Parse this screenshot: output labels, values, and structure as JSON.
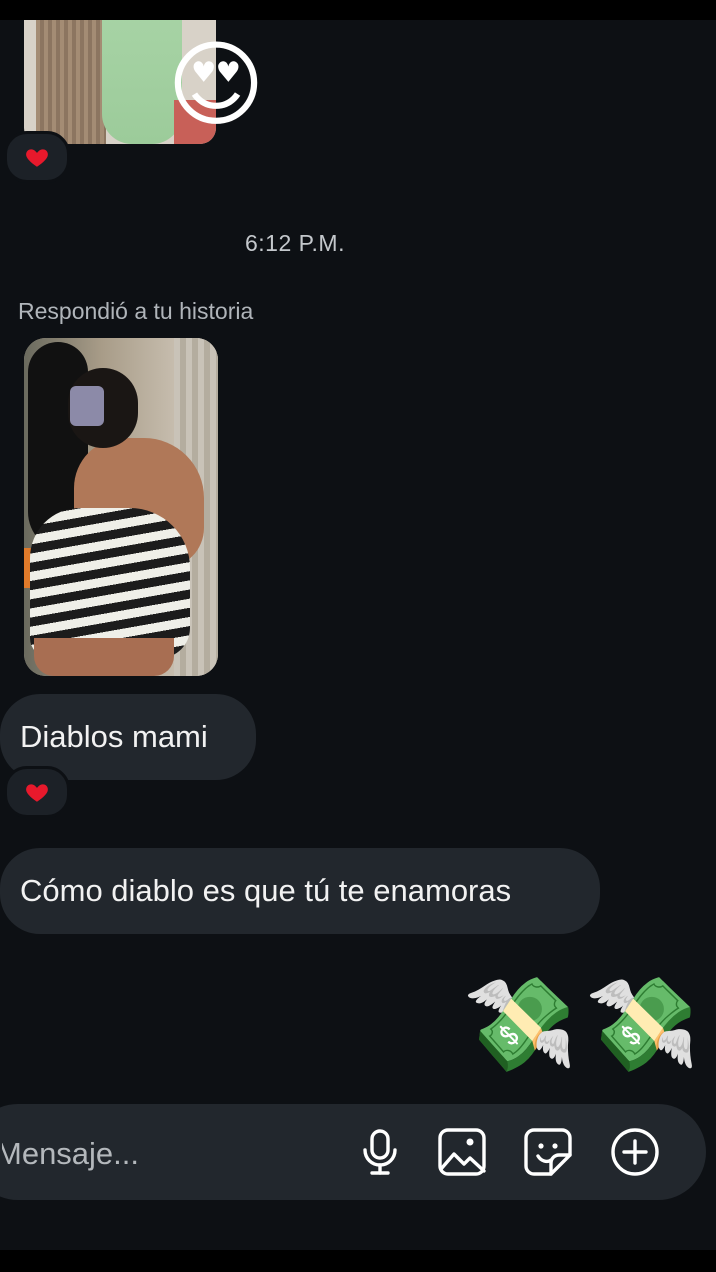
{
  "conversation": {
    "timestamp": "6:12 P.M.",
    "reply_label": "Respondió a tu historia",
    "messages": [
      {
        "text": "Diablos mami",
        "reaction": "heart"
      },
      {
        "text": "Cómo diablo es que tú te enamoras"
      }
    ],
    "stickers": {
      "top": "😍",
      "money": [
        "💸",
        "💸"
      ]
    }
  },
  "composer": {
    "placeholder": "Mensaje..."
  },
  "icons": {
    "voice": "microphone-icon",
    "gallery": "gallery-icon",
    "sticker": "sticker-icon",
    "more": "plus-circle-icon"
  },
  "colors": {
    "background": "#0d1014",
    "bubble": "#22272d",
    "reaction_heart": "#e8192c"
  }
}
